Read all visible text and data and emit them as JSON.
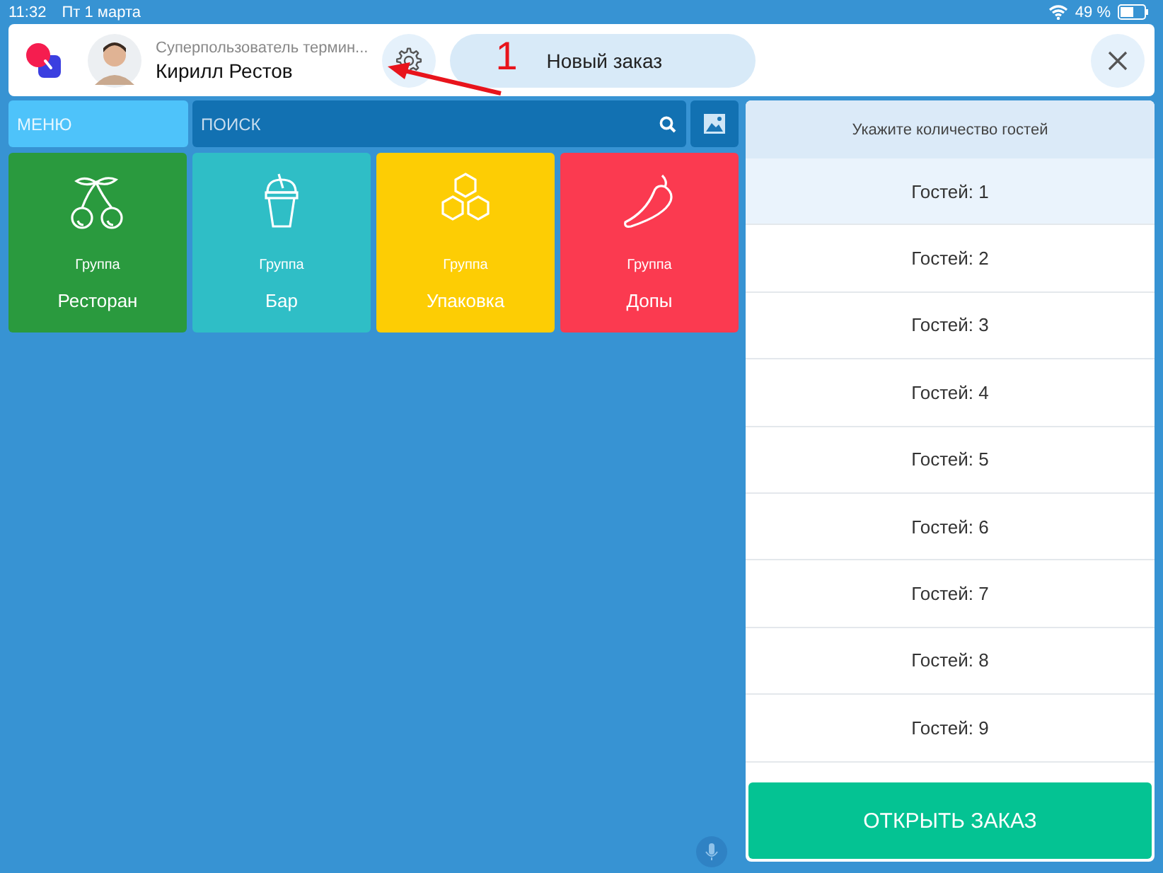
{
  "status_bar": {
    "time": "11:32",
    "date": "Пт 1 марта",
    "battery": "49 %"
  },
  "header": {
    "user_role": "Суперпользователь термин...",
    "user_name": "Кирилл Рестов",
    "new_order": "Новый заказ"
  },
  "annotation": {
    "label": "1"
  },
  "toolbar": {
    "menu_placeholder": "МЕНЮ",
    "search_placeholder": "ПОИСК"
  },
  "groups": [
    {
      "kind": "cherry",
      "caption": "Группа",
      "name": "Ресторан",
      "color": "#2a9a3e"
    },
    {
      "kind": "drink",
      "caption": "Группа",
      "name": "Бар",
      "color": "#2fbec6"
    },
    {
      "kind": "honeycomb",
      "caption": "Группа",
      "name": "Упаковка",
      "color": "#fdcd04"
    },
    {
      "kind": "pepper",
      "caption": "Группа",
      "name": "Допы",
      "color": "#fb3a50"
    }
  ],
  "guests": {
    "title": "Укажите количество гостей",
    "options": [
      {
        "label": "Гостей: 1",
        "selected": true
      },
      {
        "label": "Гостей: 2",
        "selected": false
      },
      {
        "label": "Гостей: 3",
        "selected": false
      },
      {
        "label": "Гостей: 4",
        "selected": false
      },
      {
        "label": "Гостей: 5",
        "selected": false
      },
      {
        "label": "Гостей: 6",
        "selected": false
      },
      {
        "label": "Гостей: 7",
        "selected": false
      },
      {
        "label": "Гостей: 8",
        "selected": false
      },
      {
        "label": "Гостей: 9",
        "selected": false
      }
    ]
  },
  "open_order": "ОТКРЫТЬ ЗАКАЗ"
}
